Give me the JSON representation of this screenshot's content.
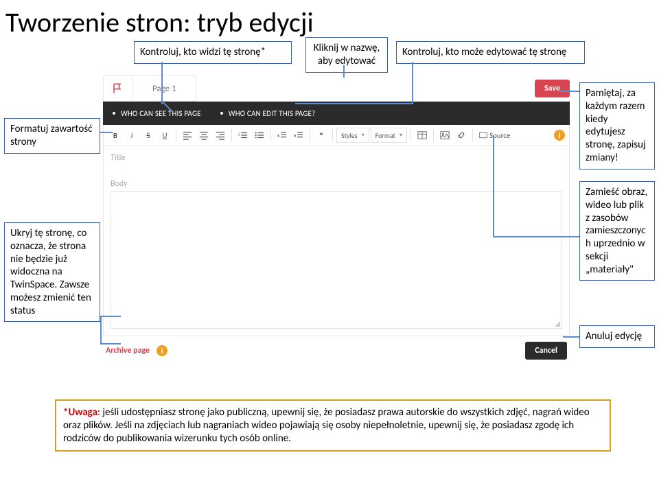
{
  "slide": {
    "title": "Tworzenie stron: tryb edycji"
  },
  "annotations": {
    "a_who_sees": "Kontroluj, kto widzi tę stronę*",
    "a_click_name": "Kliknij w nazwę, aby edytować",
    "a_who_edits": "Kontroluj, kto może edytować tę stronę",
    "a_format": "Formatuj zawartość strony",
    "a_save": "Pamiętaj, za każdym razem kiedy edytujesz stronę, zapisuj zmiany!",
    "a_hide": "Ukryj tę stronę, co oznacza, że strona nie będzie już widoczna na TwinSpace. Zawsze możesz zmienić ten status",
    "a_assets": "Zamieść obraz, wideo lub plik z zasobów zamieszczonyc h uprzednio w sekcji „materiały\"",
    "a_cancel": "Anuluj edycję",
    "warn_prefix": "*Uwaga",
    "warn_text": ": jeśli udostępniasz stronę jako publiczną, upewnij się, że posiadasz prawa autorskie do wszystkich zdjęć, nagrań wideo oraz plików. Jeśli na zdjęciach lub nagraniach wideo pojawiają się osoby niepełnoletnie, upewnij się, że posiadasz zgodę ich rodziców do publikowania wizerunku tych osób online."
  },
  "editor": {
    "page_tab": "Page 1",
    "save": "Save",
    "q_see": "WHO CAN SEE THIS PAGE",
    "q_edit": "WHO CAN EDIT THIS PAGE?",
    "toolbar": {
      "styles": "Styles",
      "format": "Format",
      "source": "Source"
    },
    "title_label": "Title",
    "body_label": "Body",
    "archive": "Archive page",
    "cancel": "Cancel"
  }
}
